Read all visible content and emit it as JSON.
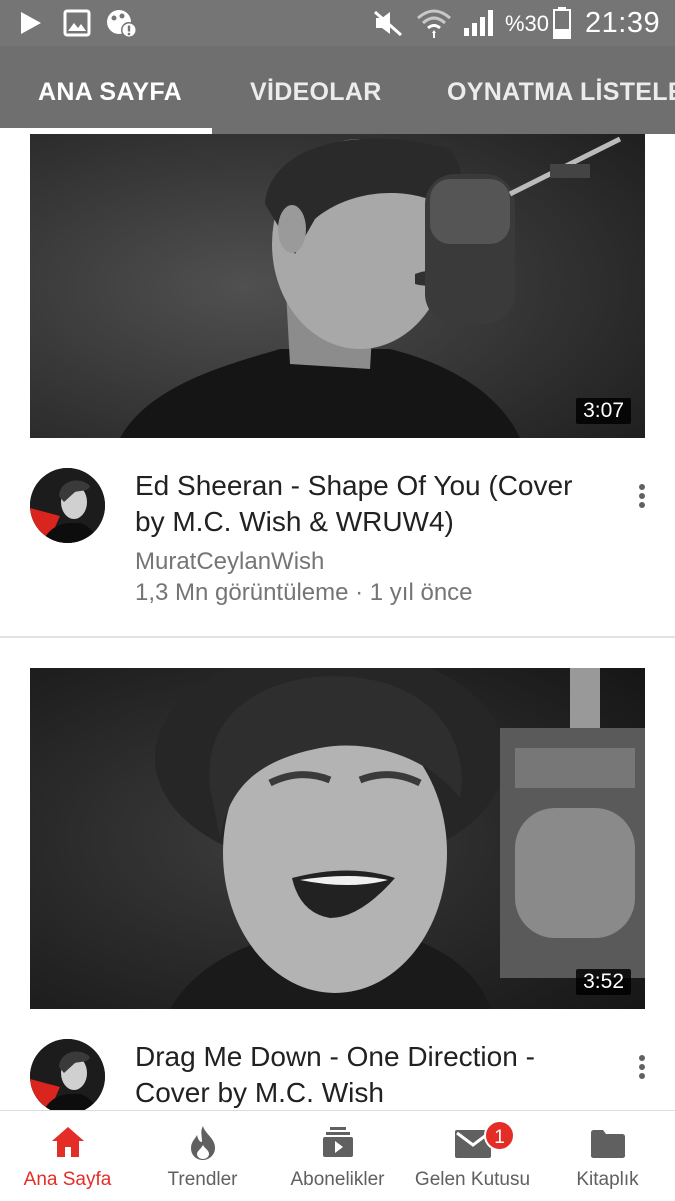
{
  "status_bar": {
    "battery_percent": "%30",
    "time": "21:39",
    "icons": [
      "play-notification-icon",
      "image-notification-icon",
      "data-alert-icon",
      "mute-icon",
      "wifi-icon",
      "cellular-signal-icon",
      "battery-icon"
    ]
  },
  "tabs": [
    {
      "label": "ANA SAYFA",
      "active": true
    },
    {
      "label": "VİDEOLAR",
      "active": false
    },
    {
      "label": "OYNATMA LİSTELERİ",
      "active": false
    }
  ],
  "videos": [
    {
      "duration": "3:07",
      "title": "Ed Sheeran - Shape Of You (Cover by M.C. Wish & WRUW4)",
      "channel": "MuratCeylanWish",
      "meta": "1,3 Mn görüntüleme · 1 yıl önce"
    },
    {
      "duration": "3:52",
      "title": "Drag Me Down - One Direction - Cover by M.C. Wish"
    }
  ],
  "bottom_nav": [
    {
      "label": "Ana Sayfa",
      "icon": "home-icon",
      "active": true
    },
    {
      "label": "Trendler",
      "icon": "flame-icon",
      "active": false
    },
    {
      "label": "Abonelikler",
      "icon": "subscriptions-icon",
      "active": false
    },
    {
      "label": "Gelen Kutusu",
      "icon": "inbox-icon",
      "active": false,
      "badge": "1"
    },
    {
      "label": "Kitaplık",
      "icon": "folder-icon",
      "active": false
    }
  ],
  "colors": {
    "accent": "#e52d27",
    "status_bar": "#757575",
    "tab_bar": "#6f6f6f",
    "text_primary": "#212121",
    "text_secondary": "#757575"
  }
}
